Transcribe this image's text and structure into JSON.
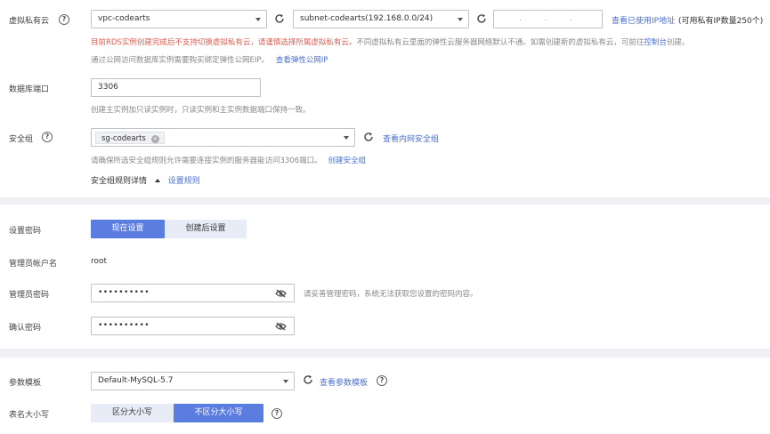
{
  "vpc": {
    "label": "虚拟私有云",
    "vpc_select": "vpc-codearts",
    "subnet_select": "subnet-codearts(192.168.0.0/24)",
    "ip_placeholder": ".         .         .",
    "view_used_ip": "查看已使用IP地址",
    "ip_count": "(可用私有IP数量250个)",
    "warning": "目前RDS实例创建完成后不支持切换虚拟私有云，请谨慎选择所属虚拟私有云。",
    "info": "不同虚拟私有云里面的弹性云服务器网络默认不通。如需创建新的虚拟私有云，可前往",
    "console_link": "控制台",
    "info_end": "创建。",
    "eip_hint": "通过公网访问数据库实例需要购买绑定弹性公网EIP。",
    "eip_link": "查看弹性公网IP"
  },
  "port": {
    "label": "数据库端口",
    "value": "3306",
    "hint": "创建主实例加只读实例时，只读实例和主实例数据端口保持一致。"
  },
  "security_group": {
    "label": "安全组",
    "tag": "sg-codearts",
    "view_link": "查看内网安全组",
    "hint": "请确保所选安全组规则允许需要连接实例的服务器能访问3306端口。",
    "create_link": "创建安全组",
    "rules_detail": "安全组规则详情",
    "rules_link": "设置规则"
  },
  "password": {
    "label": "设置密码",
    "now": "现在设置",
    "later": "创建后设置",
    "admin_label": "管理员帐户名",
    "admin_value": "root",
    "admin_pwd_label": "管理员密码",
    "admin_pwd_value": "••••••••••",
    "admin_pwd_hint": "请妥善管理密码，系统无法获取您设置的密码内容。",
    "confirm_label": "确认密码",
    "confirm_value": "••••••••••"
  },
  "params": {
    "label": "参数模板",
    "template": "Default-MySQL-5.7",
    "view_link": "查看参数模板",
    "case_label": "表名大小写",
    "case_sensitive": "区分大小写",
    "case_insensitive": "不区分大小写"
  },
  "colors": {
    "primary": "#5b7de0",
    "link": "#4a6fd1",
    "warning": "#e05a4e"
  }
}
